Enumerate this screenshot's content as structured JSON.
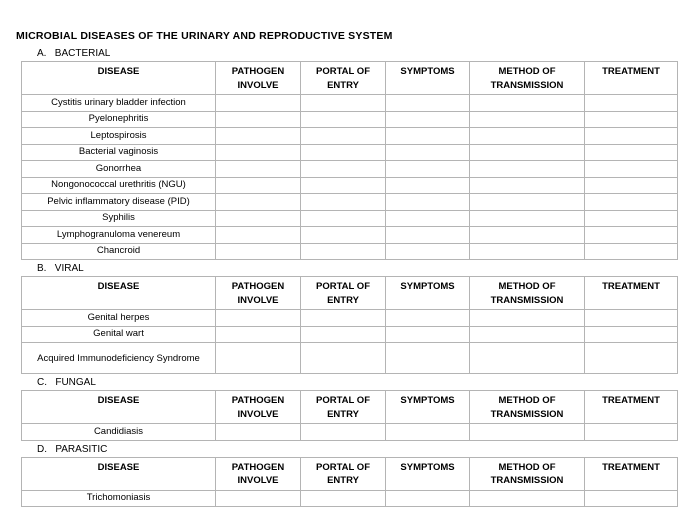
{
  "document": {
    "title": "MICROBIAL DISEASES OF THE URINARY AND REPRODUCTIVE SYSTEM"
  },
  "columns": {
    "disease": "DISEASE",
    "pathogen": "PATHOGEN INVOLVE",
    "pathogen_line1": "PATHOGEN",
    "pathogen_line2": "INVOLVE",
    "portal": "PORTAL OF ENTRY",
    "portal_line1": "PORTAL OF",
    "portal_line2": "ENTRY",
    "symptoms": "SYMPTOMS",
    "method": "METHOD OF TRANSMISSION",
    "method_line1": "METHOD OF",
    "method_line2": "TRANSMISSION",
    "treatment": "TREATMENT"
  },
  "sections": [
    {
      "label": "A.   BACTERIAL",
      "letter": "A.",
      "name": "BACTERIAL",
      "rows": [
        {
          "disease": "Cystitis urinary bladder infection"
        },
        {
          "disease": "Pyelonephritis"
        },
        {
          "disease": "Leptospirosis"
        },
        {
          "disease": "Bacterial vaginosis"
        },
        {
          "disease": "Gonorrhea"
        },
        {
          "disease": "Nongonococcal urethritis (NGU)"
        },
        {
          "disease": "Pelvic inflammatory disease (PID)"
        },
        {
          "disease": "Syphilis"
        },
        {
          "disease": "Lymphogranuloma venereum"
        },
        {
          "disease": "Chancroid"
        }
      ]
    },
    {
      "label": "B.   VIRAL",
      "letter": "B.",
      "name": "VIRAL",
      "rows": [
        {
          "disease": "Genital herpes"
        },
        {
          "disease": "Genital wart"
        },
        {
          "disease": "Acquired Immunodeficiency Syndrome"
        }
      ]
    },
    {
      "label": "C.   FUNGAL",
      "letter": "C.",
      "name": "FUNGAL",
      "rows": [
        {
          "disease": "Candidiasis"
        }
      ]
    },
    {
      "label": "D.   PARASITIC",
      "letter": "D.",
      "name": "PARASITIC",
      "rows": [
        {
          "disease": "Trichomoniasis"
        }
      ]
    }
  ],
  "colors": {
    "page_background": "#ffffff",
    "text": "#000000",
    "table_outer_border": "#7a7a7a",
    "table_inner_border": "#b4b4b4"
  }
}
